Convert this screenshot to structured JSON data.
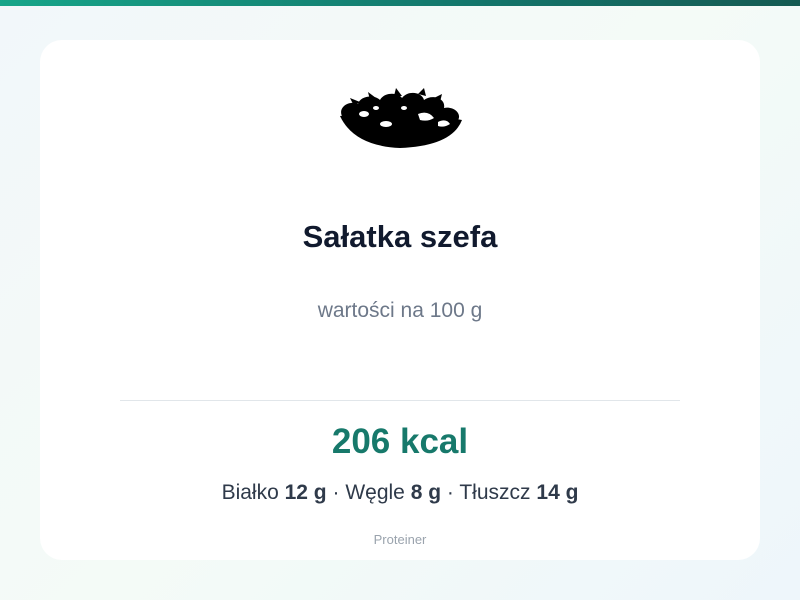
{
  "dish": {
    "title": "Sałatka szefa",
    "icon": "salad-bowl-icon",
    "per_label": "wartości na 100 g"
  },
  "nutrition": {
    "kcal_label": "206 kcal",
    "protein_label": "Białko",
    "protein_value": "12 g",
    "carbs_label": "Węgle",
    "carbs_value": "8 g",
    "fat_label": "Tłuszcz",
    "fat_value": "14 g",
    "separator": "·"
  },
  "footer": {
    "brand": "Proteiner"
  },
  "colors": {
    "accent": "#17796b",
    "title": "#111a2e",
    "muted": "#6d7889",
    "top_bar_start": "#17a589",
    "top_bar_end": "#145a52"
  }
}
